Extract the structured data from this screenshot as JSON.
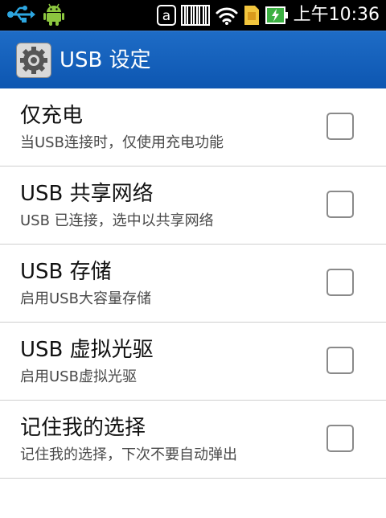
{
  "status_bar": {
    "time": "上午10:36",
    "left_icons": [
      "usb-icon",
      "android-icon"
    ],
    "right_icons": [
      "a-icon",
      "barcode-icon",
      "wifi-icon",
      "sim-icon",
      "battery-charging-icon"
    ]
  },
  "action_bar": {
    "title": "USB 设定",
    "icon": "settings-gear-icon"
  },
  "items": [
    {
      "title": "仅充电",
      "subtitle": "当USB连接时，仅使用充电功能",
      "checked": false
    },
    {
      "title": "USB 共享网络",
      "subtitle": "USB 已连接，选中以共享网络",
      "checked": false
    },
    {
      "title": "USB 存储",
      "subtitle": "启用USB大容量存储",
      "checked": false
    },
    {
      "title": "USB 虚拟光驱",
      "subtitle": "启用USB虚拟光驱",
      "checked": false
    },
    {
      "title": "记住我的选择",
      "subtitle": "记住我的选择，下次不要自动弹出",
      "checked": false
    }
  ],
  "colors": {
    "action_bar": "#1560bd",
    "status_bar": "#000000",
    "usb_icon": "#2da6e0",
    "android_icon": "#8cc63f",
    "battery": "#3cb043"
  }
}
